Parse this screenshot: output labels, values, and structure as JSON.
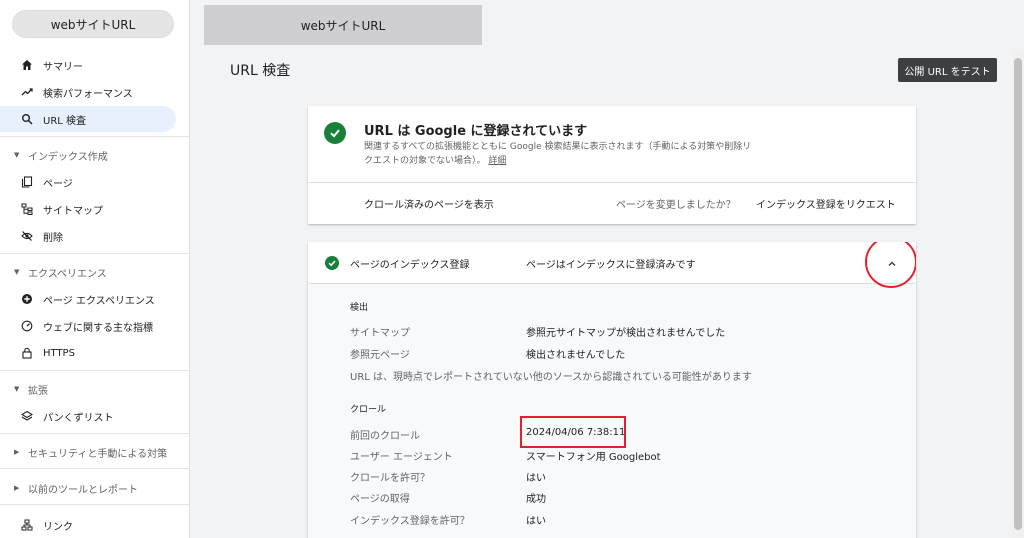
{
  "sidebar": {
    "property": "webサイトURL",
    "items": [
      {
        "label": "サマリー",
        "icon": "home-icon"
      },
      {
        "label": "検索パフォーマンス",
        "icon": "trend-icon"
      },
      {
        "label": "URL 検査",
        "icon": "search-icon",
        "active": true
      }
    ],
    "sections": {
      "index": "インデックス作成",
      "experience": "エクスペリエンス",
      "extensions": "拡張",
      "security": "セキュリティと手動による対策",
      "legacy": "以前のツールとレポート"
    },
    "index_items": [
      "ページ",
      "サイトマップ",
      "削除"
    ],
    "experience_items": [
      "ページ エクスペリエンス",
      "ウェブに関する主な指標",
      "HTTPS"
    ],
    "extension_items": [
      "パンくずリスト"
    ],
    "links": "リンク"
  },
  "top_tab": "webサイトURL",
  "page_title": "URL 検査",
  "test_button": "公開 URL をテスト",
  "status": {
    "title": "URL は Google に登録されています",
    "description": "関連するすべての拡張機能とともに Google 検索結果に表示されます（手動による対策や削除リクエストの対象でない場合）。",
    "more_link": "詳細",
    "view_crawled": "クロール済みのページを表示",
    "changed_question": "ページを変更しましたか？",
    "request_index": "インデックス登録をリクエスト"
  },
  "index_card": {
    "label": "ページのインデックス登録",
    "value": "ページはインデックスに登録済みです",
    "discovery": {
      "title": "検出",
      "rows": [
        {
          "label": "サイトマップ",
          "value": "参照元サイトマップが検出されませんでした"
        },
        {
          "label": "参照元ページ",
          "value": "検出されませんでした"
        }
      ],
      "note": "URL は、現時点でレポートされていない他のソースから認識されている可能性があります"
    },
    "crawl": {
      "title": "クロール",
      "rows": [
        {
          "label": "前回のクロール",
          "value": "2024/04/06 7:38:11"
        },
        {
          "label": "ユーザー エージェント",
          "value": "スマートフォン用 Googlebot"
        },
        {
          "label": "クロールを許可？",
          "value": "はい"
        },
        {
          "label": "ページの取得",
          "value": "成功"
        },
        {
          "label": "インデックス登録を許可？",
          "value": "はい"
        }
      ]
    }
  },
  "colors": {
    "success": "#188038",
    "highlight": "#e4202f",
    "active_nav": "#e8f0fe",
    "button": "#3c4043"
  }
}
